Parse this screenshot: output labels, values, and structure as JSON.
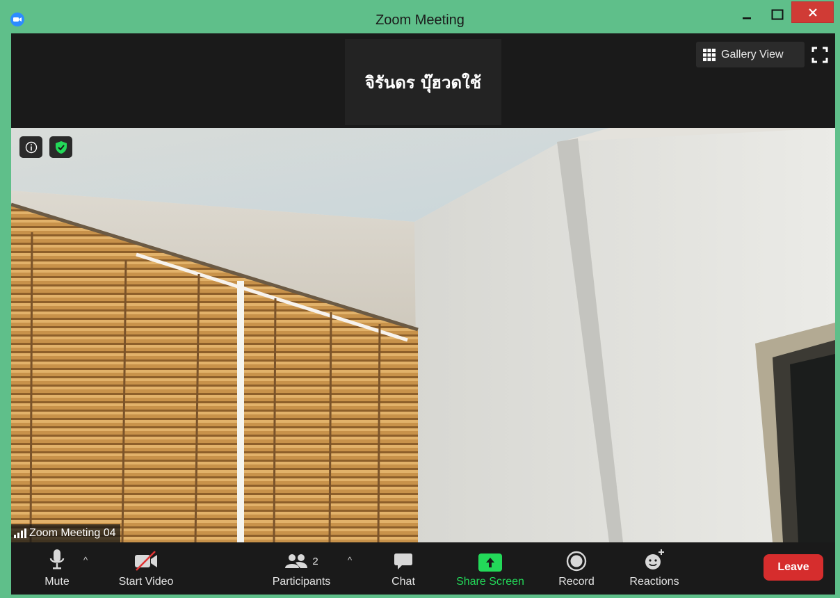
{
  "window": {
    "title": "Zoom Meeting"
  },
  "header": {
    "speaker_name": "จิรันดร บุ๊ฮวดใช้",
    "gallery_view_label": "Gallery View"
  },
  "video": {
    "name_tag": "Zoom Meeting 04"
  },
  "toolbar": {
    "mute_label": "Mute",
    "start_video_label": "Start Video",
    "participants_label": "Participants",
    "participants_count": "2",
    "chat_label": "Chat",
    "share_screen_label": "Share Screen",
    "record_label": "Record",
    "reactions_label": "Reactions",
    "leave_label": "Leave"
  },
  "colors": {
    "window_frame": "#5fbf8a",
    "toolbar_bg": "#1a1a1a",
    "share_green": "#23d959",
    "leave_red": "#d62d2d",
    "security_green": "#23d959"
  }
}
